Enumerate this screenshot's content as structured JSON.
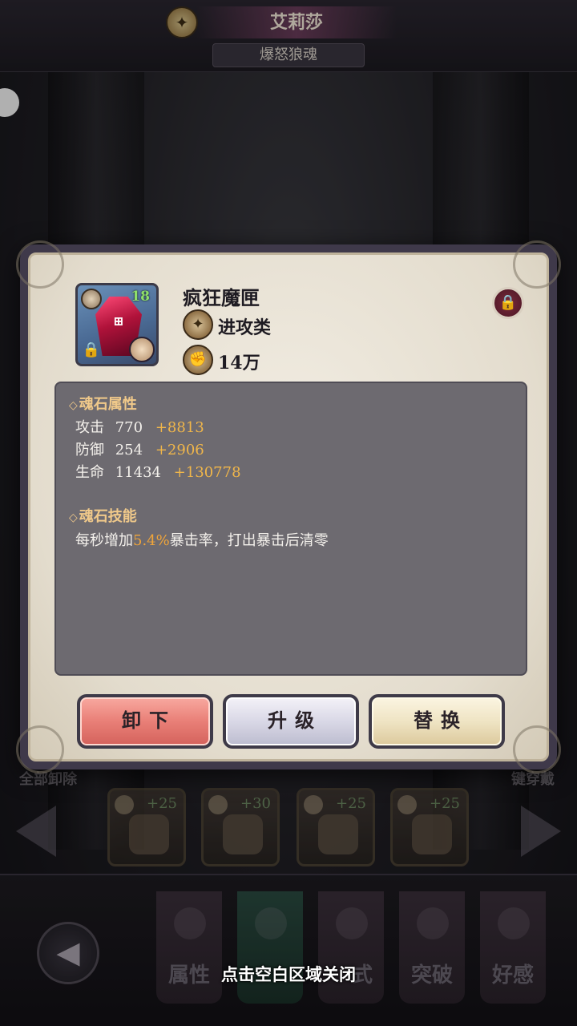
{
  "background": {
    "character_name": "艾莉莎",
    "character_title": "爆怒狼魂",
    "left_label": "全部卸除",
    "right_label": "键穿戴",
    "equip_slots": [
      {
        "icon": "helmet-icon",
        "plus": "+25"
      },
      {
        "icon": "weapon-icon",
        "plus": "+30"
      },
      {
        "icon": "boots-icon",
        "plus": "+25"
      },
      {
        "icon": "armor-icon",
        "plus": "+25"
      }
    ],
    "nav_tabs": [
      {
        "label": "属性",
        "icon": "character-icon"
      },
      {
        "label": "",
        "icon": "sword-icon"
      },
      {
        "label": "式",
        "icon": "crest-icon"
      },
      {
        "label": "突破",
        "icon": "fist-icon"
      },
      {
        "label": "好感",
        "icon": "heart-icon"
      }
    ],
    "close_hint": "点击空白区域关闭"
  },
  "dialog": {
    "item": {
      "name": "疯狂魔匣",
      "level": "18",
      "type": "进攻类",
      "power": "14万",
      "rune_glyph": "⊞"
    },
    "attributes": {
      "title": "魂石属性",
      "stats": [
        {
          "label": "攻击",
          "base": "770",
          "bonus": "+8813"
        },
        {
          "label": "防御",
          "base": "254",
          "bonus": "+2906"
        },
        {
          "label": "生命",
          "base": "11434",
          "bonus": "+130778"
        }
      ]
    },
    "skill": {
      "title": "魂石技能",
      "prefix": "每秒增加",
      "highlight": "5.4%",
      "suffix": "暴击率，打出暴击后清零"
    },
    "buttons": {
      "unequip": "卸下",
      "upgrade": "升级",
      "replace": "替换"
    }
  },
  "colors": {
    "accent_gold": "#f0b64a",
    "unequip_red": "#e97f77",
    "panel_gray": "#6d6a70"
  }
}
